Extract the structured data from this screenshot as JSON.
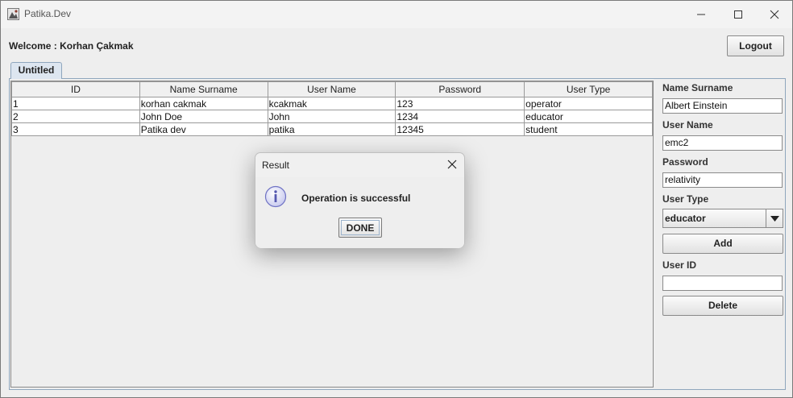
{
  "window": {
    "title": "Patika.Dev"
  },
  "welcome": {
    "label": "Welcome : Korhan Çakmak"
  },
  "logout_label": "Logout",
  "tab": {
    "label": "Untitled"
  },
  "table": {
    "columns": [
      "ID",
      "Name Surname",
      "User Name",
      "Password",
      "User Type"
    ],
    "rows": [
      [
        "1",
        "korhan cakmak",
        "kcakmak",
        "123",
        "operator"
      ],
      [
        "2",
        "John Doe",
        "John",
        "1234",
        "educator"
      ],
      [
        "3",
        "Patika dev",
        "patika",
        "12345",
        "student"
      ]
    ]
  },
  "form": {
    "name_label": "Name Surname",
    "name_value": "Albert Einstein",
    "username_label": "User Name",
    "username_value": "emc2",
    "password_label": "Password",
    "password_value": "relativity",
    "usertype_label": "User Type",
    "usertype_value": "educator",
    "add_label": "Add",
    "userid_label": "User ID",
    "userid_value": "",
    "delete_label": "Delete"
  },
  "dialog": {
    "title": "Result",
    "message": "Operation is successful",
    "button": "DONE"
  },
  "colors": {
    "tab_border": "#8fa6bd",
    "tab_bg": "#dde6f0",
    "info_icon": "#6f72c4"
  }
}
